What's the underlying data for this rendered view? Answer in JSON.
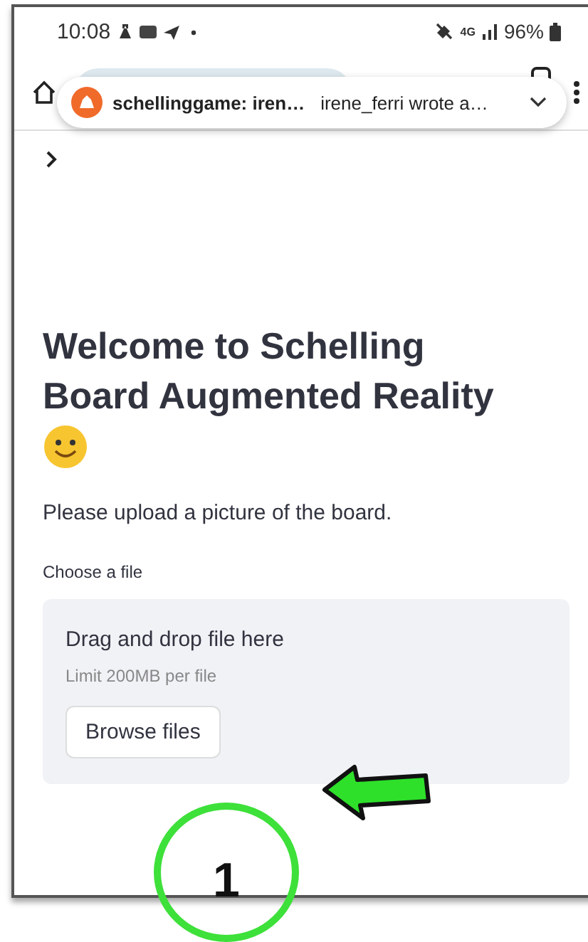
{
  "status_bar": {
    "time": "10:08",
    "network": "4G",
    "battery": "96%"
  },
  "notification": {
    "title": "schellinggame: iren…",
    "message": "irene_ferri wrote a…"
  },
  "page": {
    "heading": "Welcome to Schelling Board Augmented Reality",
    "intro": "Please upload a picture of the board.",
    "uploader": {
      "label": "Choose a file",
      "drop_text": "Drag and drop file here",
      "limit": "Limit 200MB per file",
      "button": "Browse files"
    }
  },
  "annotation": {
    "label": "1"
  }
}
